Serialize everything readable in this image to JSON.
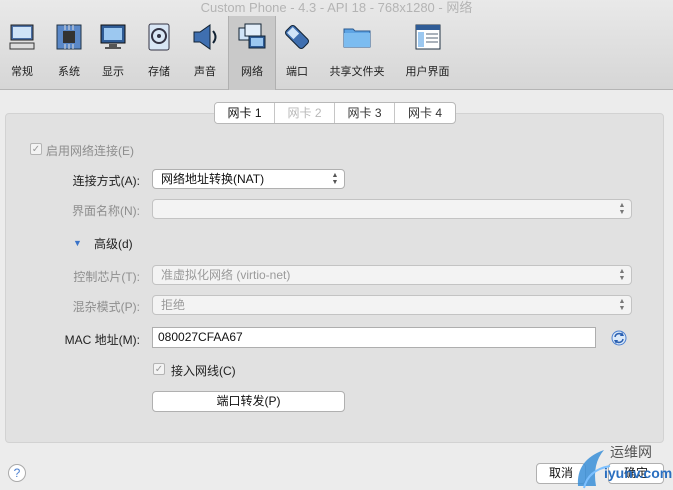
{
  "window": {
    "title": "Custom Phone - 4.3 - API 18 - 768x1280 - 网络"
  },
  "toolbar": {
    "items": [
      {
        "label": "常规",
        "icon": "monitor-computer-icon"
      },
      {
        "label": "系统",
        "icon": "chip-icon"
      },
      {
        "label": "显示",
        "icon": "display-icon"
      },
      {
        "label": "存储",
        "icon": "disk-icon"
      },
      {
        "label": "声音",
        "icon": "speaker-icon"
      },
      {
        "label": "网络",
        "icon": "network-icon"
      },
      {
        "label": "端口",
        "icon": "serial-port-icon"
      },
      {
        "label": "共享文件夹",
        "icon": "folder-icon"
      },
      {
        "label": "用户界面",
        "icon": "window-ui-icon"
      }
    ],
    "active": "网络"
  },
  "tabs": [
    "网卡 1",
    "网卡 2",
    "网卡 3",
    "网卡 4"
  ],
  "form": {
    "enable_label": "启用网络连接(E)",
    "attach_label": "连接方式(A):",
    "attach_value": "网络地址转换(NAT)",
    "name_label": "界面名称(N):",
    "name_value": "",
    "advanced_label": "高级(d)",
    "adapter_label": "控制芯片(T):",
    "adapter_value": "准虚拟化网络 (virtio-net)",
    "promisc_label": "混杂模式(P):",
    "promisc_value": "拒绝",
    "mac_label": "MAC 地址(M):",
    "mac_value": "080027CFAA67",
    "cable_label": "接入网线(C)",
    "port_forward_label": "端口转发(P)"
  },
  "footer": {
    "help": "?",
    "cancel": "取消",
    "ok": "确定"
  },
  "watermark": {
    "text": "运维网",
    "subtext": "iyunv.com"
  }
}
